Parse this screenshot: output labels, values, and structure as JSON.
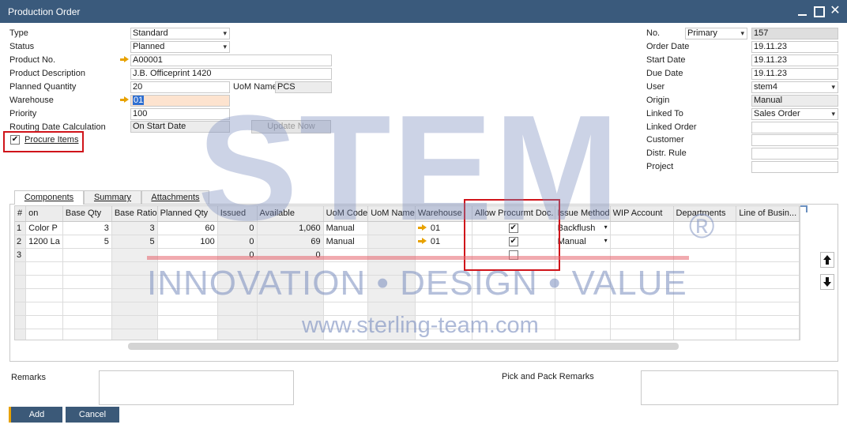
{
  "window": {
    "title": "Production Order"
  },
  "header_left": {
    "type_label": "Type",
    "type_value": "Standard",
    "status_label": "Status",
    "status_value": "Planned",
    "product_no_label": "Product No.",
    "product_no_value": "A00001",
    "product_desc_label": "Product Description",
    "product_desc_value": "J.B. Officeprint 1420",
    "planned_qty_label": "Planned Quantity",
    "planned_qty_value": "20",
    "uom_name_label": "UoM Name",
    "uom_name_value": "PCS",
    "warehouse_label": "Warehouse",
    "warehouse_value": "01",
    "priority_label": "Priority",
    "priority_value": "100",
    "routing_label": "Routing Date Calculation",
    "routing_value": "On Start Date",
    "update_now_label": "Update Now",
    "procure_items_label": "Procure Items",
    "procure_items_checked": "✔"
  },
  "header_right": {
    "no_label": "No.",
    "series_value": "Primary",
    "no_value": "157",
    "order_date_label": "Order Date",
    "order_date_value": "19.11.23",
    "start_date_label": "Start Date",
    "start_date_value": "19.11.23",
    "due_date_label": "Due Date",
    "due_date_value": "19.11.23",
    "user_label": "User",
    "user_value": "stem4",
    "origin_label": "Origin",
    "origin_value": "Manual",
    "linked_to_label": "Linked To",
    "linked_to_value": "Sales Order",
    "linked_order_label": "Linked Order",
    "linked_order_value": "",
    "customer_label": "Customer",
    "customer_value": "",
    "distr_rule_label": "Distr. Rule",
    "distr_rule_value": "",
    "project_label": "Project",
    "project_value": ""
  },
  "tabs": [
    "Components",
    "Summary",
    "Attachments"
  ],
  "grid": {
    "columns": [
      "#",
      "on",
      "Base Qty",
      "Base Ratio",
      "Planned Qty",
      "Issued",
      "Available",
      "UoM Code",
      "UoM Name",
      "Warehouse",
      "Allow Procurmt Doc.",
      "Issue Method",
      "WIP Account",
      "Departments",
      "Line of Busin..."
    ],
    "rows": [
      {
        "n": "1",
        "desc": "Color P",
        "base_qty": "3",
        "base_ratio": "3",
        "planned_qty": "60",
        "issued": "0",
        "available": "1,060",
        "uom_code": "Manual",
        "uom_name": "",
        "warehouse": "01",
        "allow_procurement": "✔",
        "issue_method": "Backflush",
        "wip": "",
        "dept": "",
        "lob": ""
      },
      {
        "n": "2",
        "desc": "1200 La",
        "base_qty": "5",
        "base_ratio": "5",
        "planned_qty": "100",
        "issued": "0",
        "available": "69",
        "uom_code": "Manual",
        "uom_name": "",
        "warehouse": "01",
        "allow_procurement": "✔",
        "issue_method": "Manual",
        "wip": "",
        "dept": "",
        "lob": ""
      },
      {
        "n": "3",
        "desc": "",
        "base_qty": "",
        "base_ratio": "",
        "planned_qty": "",
        "issued": "0",
        "available": "0",
        "uom_code": "",
        "uom_name": "",
        "warehouse": "",
        "allow_procurement": "",
        "issue_method": "",
        "wip": "",
        "dept": "",
        "lob": ""
      }
    ]
  },
  "footer": {
    "remarks_label": "Remarks",
    "pick_pack_label": "Pick and Pack Remarks",
    "add_label": "Add",
    "cancel_label": "Cancel"
  },
  "watermark": {
    "brand": "STEM",
    "registered": "®",
    "tagline": "INNOVATION • DESIGN • VALUE",
    "url": "www.sterling-team.com"
  },
  "colors": {
    "titlebar": "#3a5a7c",
    "highlight_box": "#d0141a",
    "link_arrow": "#e8a200",
    "button": "#3b5978"
  }
}
